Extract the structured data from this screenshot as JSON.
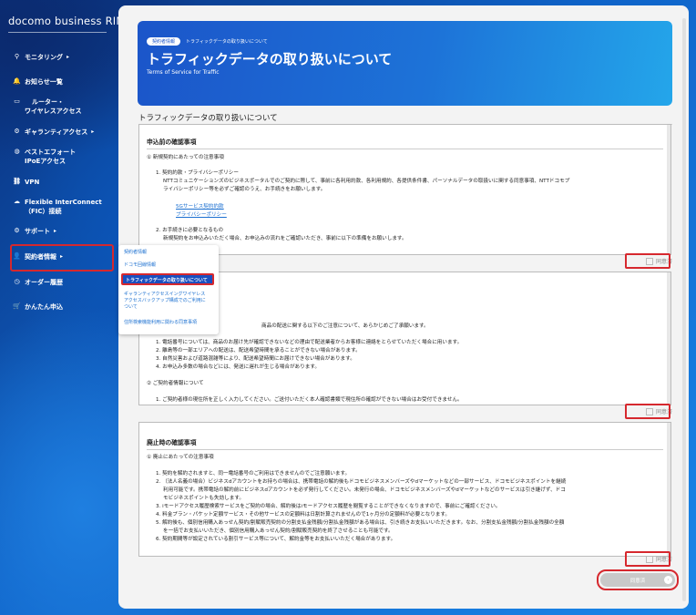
{
  "brand": {
    "logo": "docomo business RINK"
  },
  "sidebar": {
    "items": [
      {
        "label": "モニタリング",
        "icon": "search-icon",
        "glyph": "⚲",
        "arrow": "▸"
      },
      {
        "label": "お知らせ一覧",
        "icon": "bell-icon",
        "glyph": "🔔"
      },
      {
        "label_line1": "ルーター・",
        "label_line2": "ワイヤレスアクセス",
        "icon": "router-icon",
        "glyph": "▭"
      },
      {
        "label": "ギャランティアクセス",
        "icon": "gear-icon",
        "glyph": "⚙",
        "arrow": "▸"
      },
      {
        "label_line1": "ベストエフォート",
        "label_line2": "IPoEアクセス",
        "icon": "globe-icon",
        "glyph": "◍"
      },
      {
        "label": "VPN",
        "icon": "link-icon",
        "glyph": "⛓"
      },
      {
        "label_line1": "Flexible InterConnect",
        "label_line2": "（FIC）接続",
        "icon": "cloud-icon",
        "glyph": "☁"
      },
      {
        "label": "サポート",
        "icon": "settings-icon",
        "glyph": "⚙",
        "arrow": "▸"
      },
      {
        "label": "契約者情報",
        "icon": "user-icon",
        "glyph": "👤",
        "arrow": "▸"
      },
      {
        "label": "オーダー履歴",
        "icon": "clock-icon",
        "glyph": "◷"
      },
      {
        "label": "かんたん申込",
        "icon": "cart-icon",
        "glyph": "🛒"
      }
    ]
  },
  "submenu": {
    "items": [
      "契約者情報",
      "ドコモ回線情報",
      "トラフィックデータの取り扱いについて",
      "ギャランティアクセスイングワイヤレス",
      "アクセスバックアップ構成でのご利用に",
      "ついて",
      "住所検索機能利用に関わる同意事項"
    ]
  },
  "header": {
    "breadcrumb_pill": "契約者情報",
    "breadcrumb_current": "トラフィックデータの取り扱いについて",
    "title": "トラフィックデータの取り扱いについて",
    "subtitle": "Terms of Service for Traffic"
  },
  "section": {
    "title": "トラフィックデータの取り扱いについて"
  },
  "box1": {
    "heading": "申込前の確認事項",
    "lines": [
      "① 新規契約にあたっての注意事項",
      "1. 契約約款・プライバシーポリシー",
      "NTTコミュニケーションズのビジネスポータルでのご契約に際して、事前に各利用約款、各利用規約、各提供条件書、パーソナルデータの取扱いに関する同意事項、NTTドコモプ",
      "ライバシーポリシー等を必ずご確認のうえ、お手続きをお願いします。",
      "5Gサービス契約約款",
      "プライバシーポリシー",
      "2. お手続きに必要となるもの",
      "新規契約をお申込みいただく場合、お申込みの流れをご確認いただき、事前に以下の準備をお願いします。"
    ],
    "agree": "同意済"
  },
  "box2": {
    "lines": [
      "商品の配送に関する以下のご注意について、あらかじめご了承願います。",
      "1. 電話番号については、商品のお届け先が確認できないなどの理由で配送業者からお客様に連絡をとらせていただく場合に用います。",
      "2. 離島等の一部エリアへの配送は、配送希望時間を承ることができない場合があります。",
      "3. 自然災害および道路混雑等により、配送希望時間にお届けできない場合があります。",
      "4. お申込み多数の場合などには、発送に遅れが生じる場合があります。",
      "② ご契約者情報について",
      "1. ご契約者様の現住所を正しく入力してください。ご送付いただく本人確認書類で現住所の確認ができない場合はお受付できません。"
    ],
    "agree": "同意済"
  },
  "box3": {
    "heading": "廃止時の確認事項",
    "lines": [
      "① 廃止にあたっての注意事項",
      "1. 契約を解約されますと、同一電話番号のご利用はできませんのでご注意願います。",
      "2. （法人名義の場合）ビジネスdアカウントをお持ちの場合は、携帯電話の解約後もドコモビジネスメンバーズやdマーケットなどの一部サービス、ドコモビジネスポイントを継続",
      "利用可能です。携帯電話の解約前にビジネスdアカウントを必ず発行してください。未発行の場合、ドコモビジネスメンバーズやdマーケットなどのサービスは引き継げず、ドコ",
      "モビジネスポイントも失効します。",
      "3. iモードアクセス履歴検索サービスをご契約の場合、解約後はiモードアクセス履歴を閲覧することができなくなりますので、事前にご確認ください。",
      "4. 料金プラン・パケット定額サービス・その他サービスの定額料は日割計算されませんので1ヶ月分の定額料が必要となります。",
      "5. 解約後も、個別信用購入あっせん契約/割賦販売契約の分割支払金残額/分割払金残額がある場合は、引き続きお支払いいただきます。なお、分割支払金残額/分割払金残額の全額",
      "を一括でお支払いいただき、個別信用購入あっせん契約/割賦販売契約を終了させることも可能です。",
      "6. 契約期間等が設定されている割引サービス等について、解約金等をお支払いいただく場合があります。"
    ],
    "agree": "同意済"
  },
  "submit": {
    "label": "同意済",
    "arrow": "›"
  }
}
